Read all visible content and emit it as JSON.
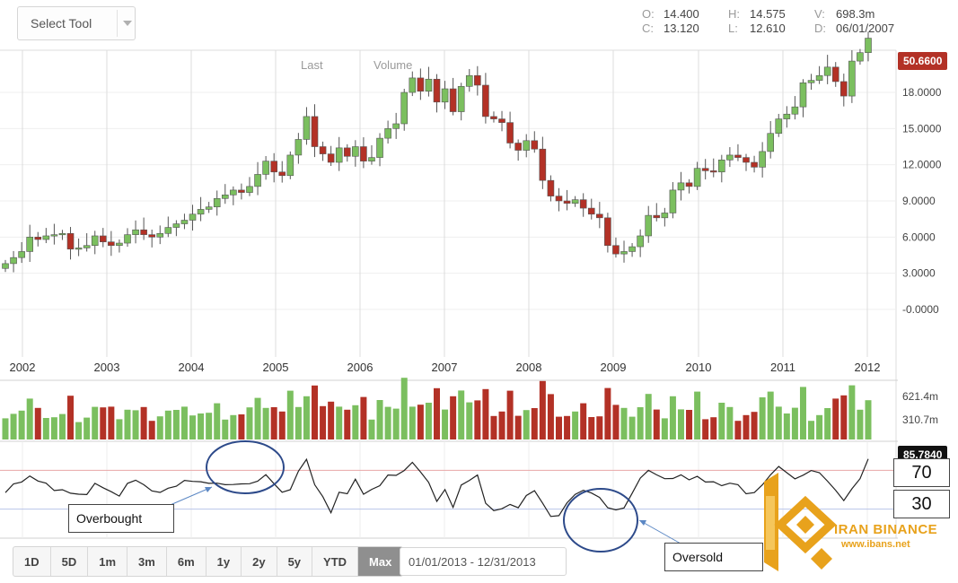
{
  "toolbar": {
    "select_tool_label": "Select Tool",
    "ohlc": [
      {
        "key": "O:",
        "value": "14.400"
      },
      {
        "key": "H:",
        "value": "14.575"
      },
      {
        "key": "V:",
        "value": "698.3m"
      },
      {
        "key": "C:",
        "value": "13.120"
      },
      {
        "key": "L:",
        "value": "12.610"
      },
      {
        "key": "D:",
        "value": "06/01/2007"
      }
    ],
    "series_labels": {
      "last": "Last",
      "volume": "Volume"
    }
  },
  "chart_data": [
    {
      "type": "candlestick",
      "x_tick_labels": [
        "2002",
        "2003",
        "2004",
        "2005",
        "2006",
        "2007",
        "2008",
        "2009",
        "2010",
        "2011",
        "2012"
      ],
      "y_tick_labels": [
        "18.0000",
        "15.0000",
        "12.0000",
        "9.0000",
        "6.0000",
        "3.0000",
        "-0.0000"
      ],
      "ylim": [
        -3.5,
        21.5
      ],
      "last_price_label": "50.6600",
      "grid": true,
      "up_color": "#7bbf5f",
      "down_color": "#b33126",
      "closes": [
        3.8,
        4.3,
        4.8,
        6.0,
        5.8,
        6.1,
        6.2,
        6.3,
        5.0,
        5.1,
        5.3,
        6.1,
        5.6,
        5.3,
        5.5,
        6.2,
        6.6,
        6.2,
        6.0,
        6.3,
        6.8,
        7.1,
        7.4,
        7.9,
        8.3,
        8.5,
        9.2,
        9.5,
        9.9,
        9.7,
        10.2,
        11.2,
        12.3,
        11.4,
        11.1,
        12.8,
        14.1,
        16.0,
        13.5,
        12.9,
        12.2,
        13.4,
        12.7,
        13.5,
        12.3,
        12.6,
        14.2,
        15.0,
        15.4,
        18.0,
        19.2,
        18.1,
        19.1,
        17.2,
        18.3,
        16.4,
        18.5,
        19.4,
        18.6,
        16.0,
        15.8,
        15.5,
        13.8,
        13.2,
        14.0,
        13.3,
        10.7,
        9.4,
        9.0,
        8.8,
        9.1,
        8.4,
        7.9,
        7.6,
        5.3,
        4.6,
        4.8,
        5.2,
        6.1,
        7.8,
        7.6,
        8.0,
        9.9,
        10.5,
        10.2,
        11.7,
        11.5,
        11.4,
        12.4,
        12.8,
        12.6,
        12.2,
        11.8,
        13.1,
        14.6,
        15.8,
        16.2,
        16.8,
        18.8,
        19.0,
        19.4,
        20.1,
        18.9,
        17.7,
        20.6,
        21.3,
        22.5
      ],
      "volume_axis_labels": [
        "621.4m",
        "310.7m"
      ]
    },
    {
      "type": "line",
      "indicator": "oscillator",
      "last_value_label": "85.7840",
      "levels": [
        {
          "label": "70",
          "value": 70
        },
        {
          "label": "30",
          "value": 30
        }
      ],
      "level_colors": {
        "upper": "#e8a7a7",
        "lower": "#b9c4ea"
      }
    }
  ],
  "annotations": {
    "overbought": "Overbought",
    "oversold": "Oversold"
  },
  "range_buttons": [
    "1D",
    "5D",
    "1m",
    "3m",
    "6m",
    "1y",
    "2y",
    "5y",
    "YTD",
    "Max"
  ],
  "active_range": "Max",
  "date_range": "01/01/2013 - 12/31/2013",
  "logo": {
    "name": "IRAN BINANCE",
    "url": "www.ibans.net"
  }
}
